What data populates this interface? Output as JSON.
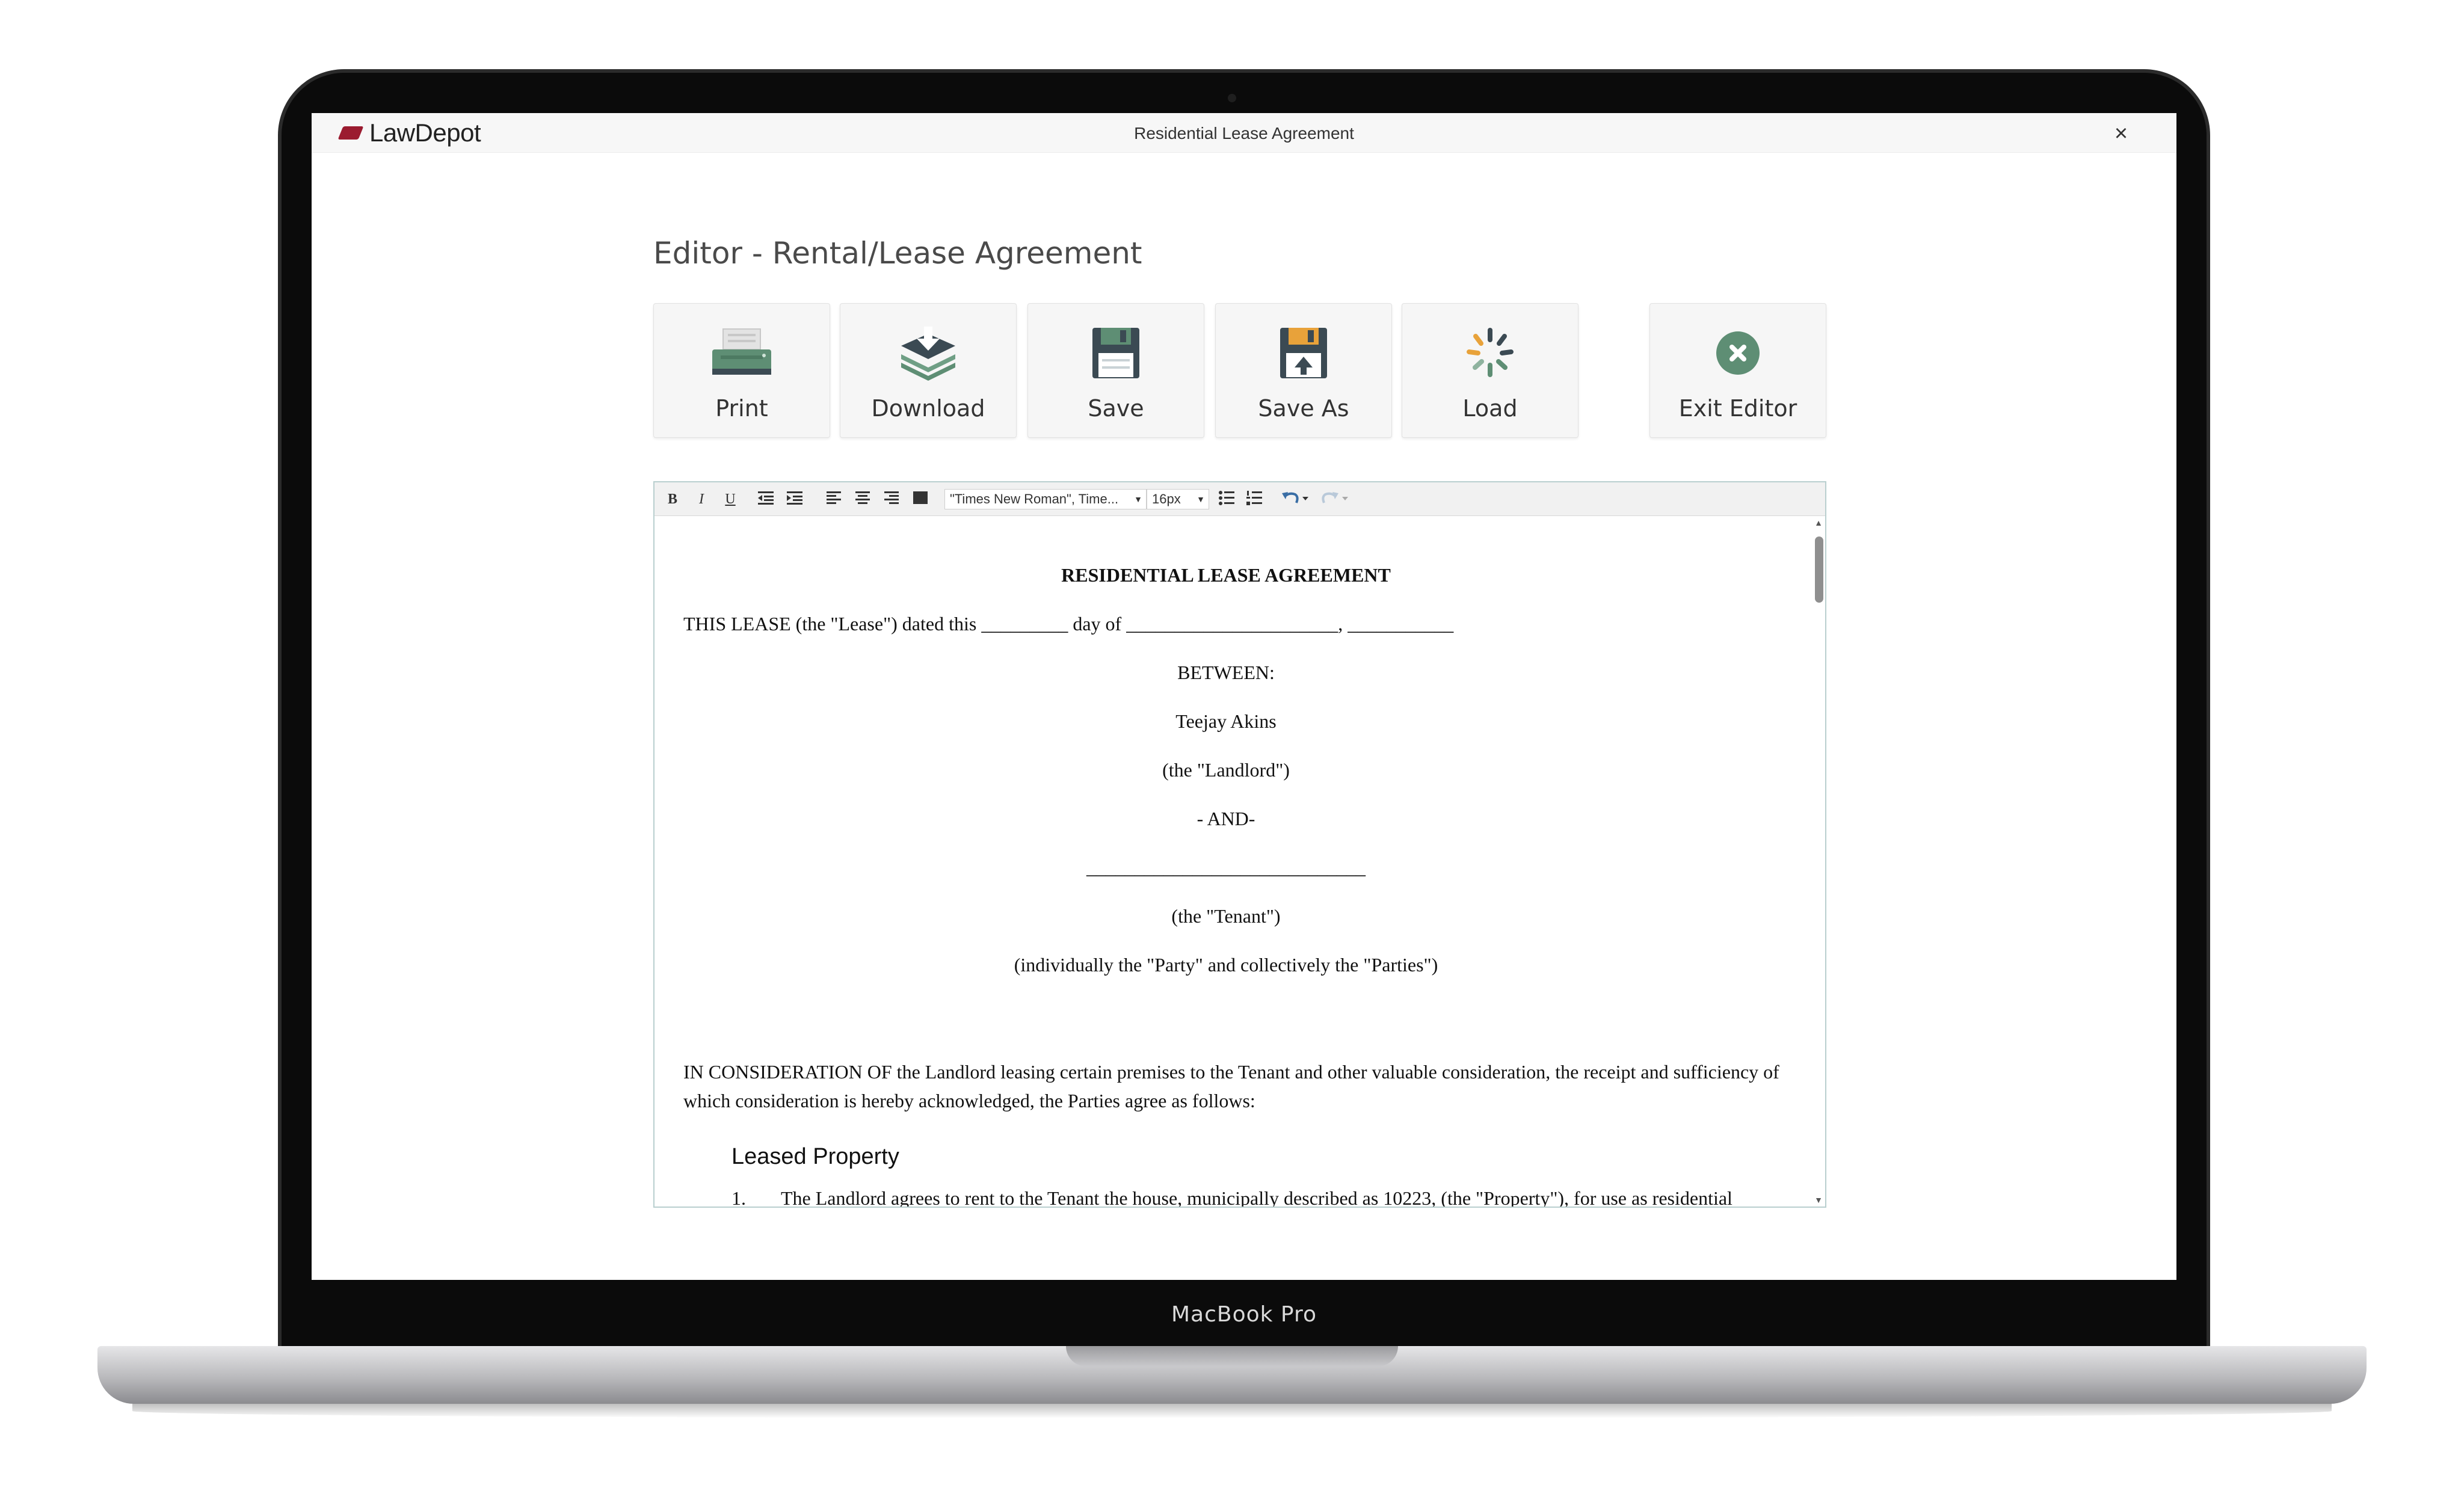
{
  "device": {
    "label": "MacBook Pro"
  },
  "header": {
    "logo_text": "LawDepot",
    "window_title": "Residential Lease Agreement",
    "close_glyph": "×"
  },
  "page_title": "Editor - Rental/Lease Agreement",
  "actions": [
    {
      "label": "Print",
      "icon": "printer-icon"
    },
    {
      "label": "Download",
      "icon": "download-icon"
    },
    {
      "label": "Save",
      "icon": "floppy-disk-icon"
    },
    {
      "label": "Save As",
      "icon": "floppy-disk-upload-icon"
    },
    {
      "label": "Load",
      "icon": "loading-spinner-icon"
    },
    {
      "label": "Exit Editor",
      "icon": "close-circle-icon"
    }
  ],
  "toolbar": {
    "bold": "B",
    "italic": "I",
    "underline": "U",
    "font_family": "\"Times New Roman\", Time...",
    "font_size": "16px"
  },
  "document": {
    "title": "RESIDENTIAL LEASE AGREEMENT",
    "dated_line": "THIS LEASE (the \"Lease\") dated this _________ day of ______________________, ___________",
    "between": "BETWEEN:",
    "landlord_name": "Teejay Akins",
    "landlord_role": "(the \"Landlord\")",
    "and": "- AND-",
    "tenant_blank": "_____________________________",
    "tenant_role": "(the \"Tenant\")",
    "parties": "(individually the \"Party\" and collectively the \"Parties\")",
    "consideration_1": "IN CONSIDERATION OF the Landlord leasing certain premises to the Tenant and other valuable consideration, the receipt and sufficiency of",
    "consideration_2": "which consideration is hereby acknowledged, the Parties agree as follows:",
    "section_heading": "Leased Property",
    "clause_1_number": "1.",
    "clause_1_text": "The Landlord agrees to rent to the Tenant the house, municipally described as 10223, (the \"Property\"), for use as residential"
  },
  "colors": {
    "brand": "#9b1b30",
    "icon_green": "#5e8e74",
    "icon_dark": "#3b4a53",
    "spinner_orange": "#e8a23a"
  }
}
